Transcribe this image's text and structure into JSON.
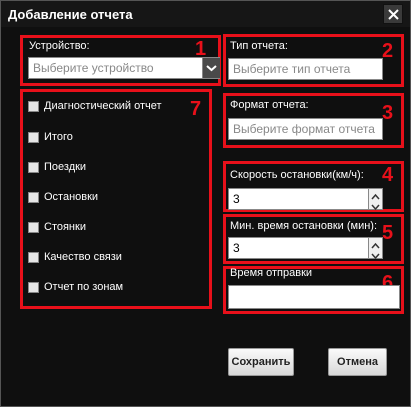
{
  "dialog": {
    "title": "Добавление отчета",
    "close_icon": "close-icon"
  },
  "device": {
    "label": "Устройство:",
    "placeholder": "Выберите устройство",
    "number": "1"
  },
  "report_type": {
    "label": "Тип отчета:",
    "placeholder": "Выберите тип отчета",
    "number": "2"
  },
  "report_format": {
    "label": "Формат отчета:",
    "placeholder": "Выберите формат отчета",
    "number": "3"
  },
  "stop_speed": {
    "label": "Скорость остановки(км/ч):",
    "value": "3",
    "number": "4"
  },
  "min_stop_time": {
    "label": "Мин. время остановки (мин):",
    "value": "3",
    "number": "5"
  },
  "send_time": {
    "label": "Время отправки",
    "value": "",
    "number": "6"
  },
  "sections": {
    "number": "7",
    "items": [
      {
        "label": "Диагностический отчет",
        "checked": false
      },
      {
        "label": "Итого",
        "checked": false
      },
      {
        "label": "Поездки",
        "checked": false
      },
      {
        "label": "Остановки",
        "checked": false
      },
      {
        "label": "Стоянки",
        "checked": false
      },
      {
        "label": "Качество связи",
        "checked": false
      },
      {
        "label": "Отчет по зонам",
        "checked": false
      }
    ]
  },
  "buttons": {
    "save": "Сохранить",
    "cancel": "Отмена"
  },
  "colors": {
    "annotation": "#e8101a",
    "dialog_bg": "#0f0f0f"
  }
}
